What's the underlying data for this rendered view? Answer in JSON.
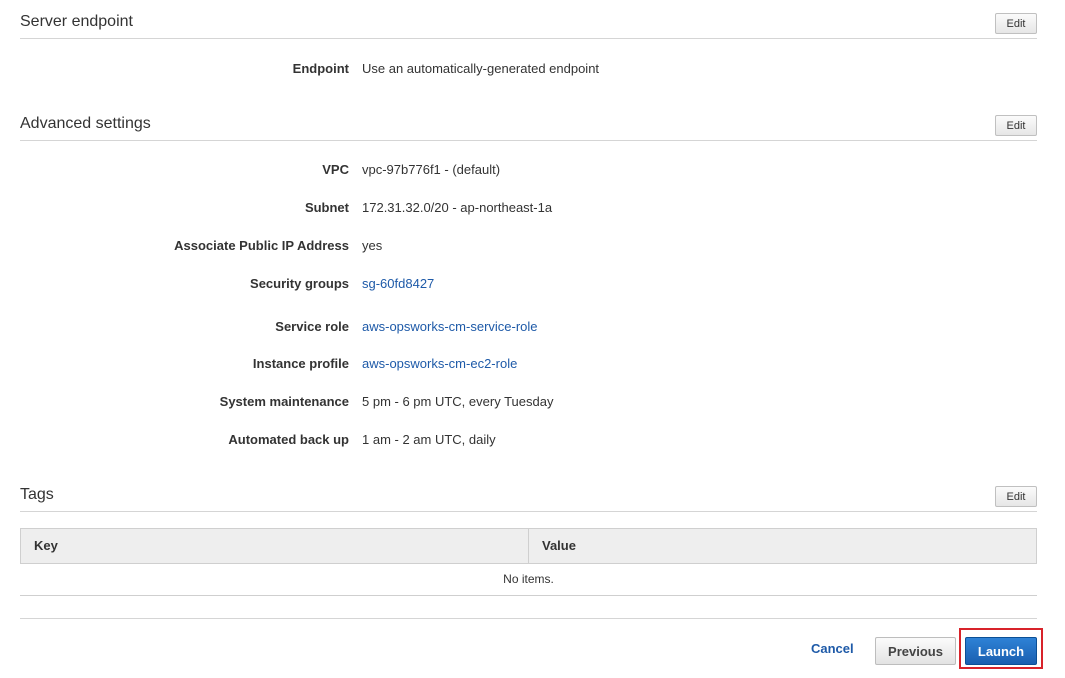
{
  "server_endpoint": {
    "title": "Server endpoint",
    "edit_label": "Edit",
    "rows": [
      {
        "label": "Endpoint",
        "value": "Use an automatically-generated endpoint"
      }
    ]
  },
  "advanced_settings": {
    "title": "Advanced settings",
    "edit_label": "Edit",
    "rows": [
      {
        "label": "VPC",
        "value": "vpc-97b776f1 - (default)"
      },
      {
        "label": "Subnet",
        "value": "172.31.32.0/20 - ap-northeast-1a"
      },
      {
        "label": "Associate Public IP Address",
        "value": "yes"
      },
      {
        "label": "Security groups",
        "value": "sg-60fd8427"
      },
      {
        "label": "Service role",
        "value": "aws-opsworks-cm-service-role"
      },
      {
        "label": "Instance profile",
        "value": "aws-opsworks-cm-ec2-role"
      },
      {
        "label": "System maintenance",
        "value": "5 pm - 6 pm UTC, every Tuesday"
      },
      {
        "label": "Automated back up",
        "value": "1 am - 2 am UTC, daily"
      }
    ]
  },
  "tags": {
    "title": "Tags",
    "edit_label": "Edit",
    "columns": [
      "Key",
      "Value"
    ],
    "empty_text": "No items."
  },
  "footer": {
    "cancel_label": "Cancel",
    "previous_label": "Previous",
    "launch_label": "Launch"
  },
  "colors": {
    "link": "#1e5aa8",
    "primary_button": "#1a5fb0",
    "highlight_frame": "#d8232a"
  }
}
